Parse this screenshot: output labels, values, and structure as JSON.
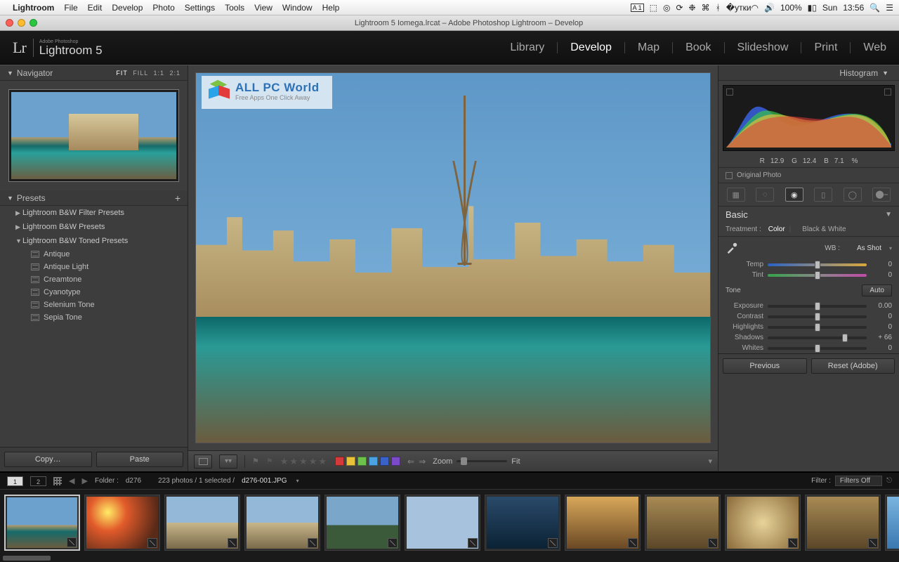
{
  "mac_menu": {
    "app": "Lightroom",
    "items": [
      "File",
      "Edit",
      "Develop",
      "Photo",
      "Settings",
      "Tools",
      "View",
      "Window",
      "Help"
    ],
    "tray": {
      "adobe_badge": "1",
      "battery": "100%",
      "day": "Sun",
      "time": "13:56"
    }
  },
  "window": {
    "title": "Lightroom 5 Iomega.lrcat – Adobe Photoshop Lightroom – Develop"
  },
  "brand": {
    "small": "Adobe Photoshop",
    "product": "Lightroom 5",
    "lr": "Lr"
  },
  "modules": [
    "Library",
    "Develop",
    "Map",
    "Book",
    "Slideshow",
    "Print",
    "Web"
  ],
  "active_module": "Develop",
  "navigator": {
    "title": "Navigator",
    "zoom_opts": [
      "FIT",
      "FILL",
      "1:1",
      "2:1"
    ],
    "zoom_selected": "FIT"
  },
  "presets": {
    "title": "Presets",
    "groups": [
      {
        "name": "Lightroom B&W Filter Presets",
        "open": false
      },
      {
        "name": "Lightroom B&W Presets",
        "open": false
      },
      {
        "name": "Lightroom B&W Toned Presets",
        "open": true,
        "items": [
          "Antique",
          "Antique Light",
          "Creamtone",
          "Cyanotype",
          "Selenium Tone",
          "Sepia Tone"
        ]
      }
    ]
  },
  "left_buttons": {
    "copy": "Copy…",
    "paste": "Paste"
  },
  "watermark": {
    "line1": "ALL PC World",
    "line2": "Free Apps One Click Away"
  },
  "center_toolbar": {
    "swatch_colors": [
      "#d43a3a",
      "#e8c23a",
      "#6cc24a",
      "#4aa3e0",
      "#3a62c8",
      "#7a4ac8"
    ],
    "zoom_label": "Zoom",
    "fit_label": "Fit"
  },
  "histogram": {
    "title": "Histogram",
    "readout": {
      "R": "12.9",
      "G": "12.4",
      "B": "7.1",
      "pct": "%"
    },
    "original_label": "Original Photo"
  },
  "basic": {
    "title": "Basic",
    "treatment_label": "Treatment :",
    "treat_color": "Color",
    "treat_bw": "Black & White",
    "wb_label": "WB :",
    "wb_value": "As Shot",
    "temp_label": "Temp",
    "temp_val": "0",
    "tint_label": "Tint",
    "tint_val": "0",
    "tone_label": "Tone",
    "auto_label": "Auto",
    "sliders": [
      {
        "label": "Exposure",
        "val": "0.00",
        "pos": 50
      },
      {
        "label": "Contrast",
        "val": "0",
        "pos": 50
      },
      {
        "label": "Highlights",
        "val": "0",
        "pos": 50
      },
      {
        "label": "Shadows",
        "val": "+ 66",
        "pos": 78
      },
      {
        "label": "Whites",
        "val": "0",
        "pos": 50
      }
    ]
  },
  "right_buttons": {
    "prev": "Previous",
    "reset": "Reset (Adobe)"
  },
  "info": {
    "views": [
      "1",
      "2"
    ],
    "folder_label": "Folder :",
    "folder": "d276",
    "count_text": "223 photos / 1 selected /",
    "filename": "d276-001.JPG",
    "filter_label": "Filter :",
    "filter_value": "Filters Off"
  },
  "filmstrip_count": 12
}
